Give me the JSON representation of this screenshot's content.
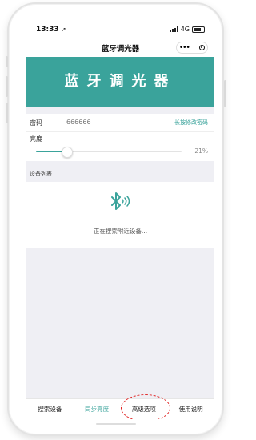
{
  "status_bar": {
    "time": "13:33",
    "network": "4G"
  },
  "nav": {
    "title": "蓝牙调光器"
  },
  "banner": {
    "title": "蓝牙调光器"
  },
  "password": {
    "label": "密码",
    "value": "666666",
    "action_link": "长按修改密码"
  },
  "brightness": {
    "label": "亮度",
    "value_text": "21%",
    "level": 0.21
  },
  "device_list": {
    "title": "设备列表",
    "status_text": "正在搜索附近设备..."
  },
  "tabbar": {
    "tabs": [
      {
        "label": "搜索设备"
      },
      {
        "label": "同步亮度"
      },
      {
        "label": "高级选项"
      },
      {
        "label": "使用说明"
      }
    ],
    "active_index": 1,
    "highlighted_index": 2
  },
  "colors": {
    "accent": "#3aa39b",
    "highlight_ring": "#e02020"
  }
}
